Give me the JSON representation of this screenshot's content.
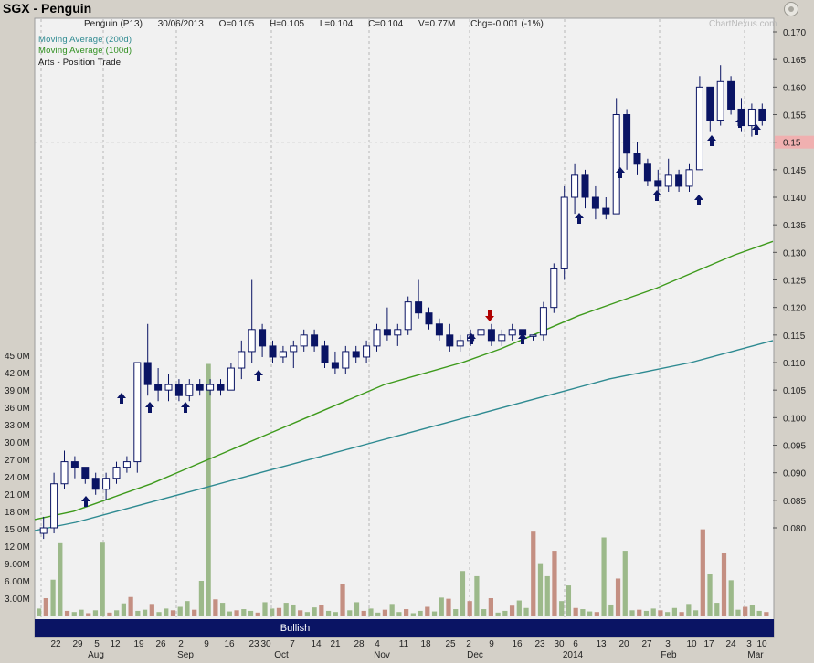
{
  "header": {
    "title": "SGX - Penguin",
    "stock": "Penguin (P13)",
    "date": "30/06/2013",
    "open": "O=0.105",
    "high": "H=0.105",
    "low": "L=0.104",
    "close": "C=0.104",
    "volume": "V=0.77M",
    "change": "Chg=-0.001 (-1%)",
    "brand": "ChartNexus.com"
  },
  "legend": {
    "ma200": "Moving Average (200d)",
    "ma100": "Moving Average (100d)",
    "arts": "Arts - Position Trade"
  },
  "status_bar": {
    "label": "Bullish"
  },
  "colors": {
    "background": "#d4d0c8",
    "plot": "#f1f1f1",
    "up_candle": "#ffffff",
    "down_candle": "#0a1464",
    "ma200": "#2e8a91",
    "ma100": "#3e9a1c",
    "vol_up": "#9cb98a",
    "vol_down": "#c48f82",
    "buy_arrow": "#0a1464",
    "sell_arrow": "#b00000",
    "status_bar": "#0a1464",
    "current_price_box": "#f0b0b0"
  },
  "chart_data": {
    "type": "candlestick",
    "price_axis": {
      "min": 0.075,
      "max": 0.17,
      "ticks": [
        "0.170",
        "0.165",
        "0.160",
        "0.155",
        "0.15",
        "0.145",
        "0.140",
        "0.135",
        "0.130",
        "0.125",
        "0.120",
        "0.115",
        "0.110",
        "0.105",
        "0.100",
        "0.095",
        "0.090",
        "0.085",
        "0.080"
      ]
    },
    "current_price": 0.15,
    "volume_axis": {
      "unit": "M",
      "max": 45,
      "ticks": [
        "45.0M",
        "42.0M",
        "39.0M",
        "36.0M",
        "33.0M",
        "30.0M",
        "27.0M",
        "24.0M",
        "21.0M",
        "18.0M",
        "15.0M",
        "12.0M",
        "9.00M",
        "6.00M",
        "3.00M"
      ]
    },
    "x_day_labels": [
      "22",
      "29",
      "5",
      "12",
      "19",
      "26",
      "2",
      "9",
      "16",
      "23",
      "30",
      "7",
      "14",
      "21",
      "28",
      "4",
      "11",
      "18",
      "25",
      "2",
      "9",
      "16",
      "23",
      "30",
      "6",
      "13",
      "20",
      "27",
      "3",
      "10",
      "17",
      "24",
      "3",
      "10"
    ],
    "x_month_labels": [
      "Aug",
      "Sep",
      "Oct",
      "Nov",
      "Dec",
      "2014",
      "Feb",
      "Mar"
    ],
    "candles": [
      [
        0.079,
        0.082,
        0.078,
        0.08
      ],
      [
        0.08,
        0.09,
        0.079,
        0.088
      ],
      [
        0.088,
        0.094,
        0.087,
        0.092
      ],
      [
        0.092,
        0.093,
        0.089,
        0.091
      ],
      [
        0.091,
        0.091,
        0.088,
        0.089
      ],
      [
        0.089,
        0.09,
        0.086,
        0.087
      ],
      [
        0.087,
        0.09,
        0.085,
        0.089
      ],
      [
        0.089,
        0.092,
        0.088,
        0.091
      ],
      [
        0.091,
        0.093,
        0.09,
        0.092
      ],
      [
        0.092,
        0.11,
        0.09,
        0.11
      ],
      [
        0.11,
        0.117,
        0.104,
        0.106
      ],
      [
        0.106,
        0.109,
        0.103,
        0.105
      ],
      [
        0.105,
        0.108,
        0.103,
        0.106
      ],
      [
        0.106,
        0.107,
        0.103,
        0.104
      ],
      [
        0.104,
        0.107,
        0.103,
        0.106
      ],
      [
        0.106,
        0.107,
        0.104,
        0.105
      ],
      [
        0.105,
        0.107,
        0.104,
        0.106
      ],
      [
        0.106,
        0.107,
        0.104,
        0.105
      ],
      [
        0.105,
        0.11,
        0.105,
        0.109
      ],
      [
        0.109,
        0.114,
        0.107,
        0.112
      ],
      [
        0.112,
        0.125,
        0.11,
        0.116
      ],
      [
        0.116,
        0.117,
        0.111,
        0.113
      ],
      [
        0.113,
        0.114,
        0.11,
        0.111
      ],
      [
        0.111,
        0.113,
        0.11,
        0.112
      ],
      [
        0.112,
        0.114,
        0.109,
        0.113
      ],
      [
        0.113,
        0.116,
        0.112,
        0.115
      ],
      [
        0.115,
        0.116,
        0.112,
        0.113
      ],
      [
        0.113,
        0.114,
        0.109,
        0.11
      ],
      [
        0.11,
        0.112,
        0.108,
        0.109
      ],
      [
        0.109,
        0.113,
        0.108,
        0.112
      ],
      [
        0.112,
        0.113,
        0.11,
        0.111
      ],
      [
        0.111,
        0.114,
        0.11,
        0.113
      ],
      [
        0.113,
        0.117,
        0.112,
        0.116
      ],
      [
        0.116,
        0.12,
        0.114,
        0.115
      ],
      [
        0.115,
        0.117,
        0.113,
        0.116
      ],
      [
        0.116,
        0.122,
        0.115,
        0.121
      ],
      [
        0.121,
        0.125,
        0.118,
        0.119
      ],
      [
        0.119,
        0.12,
        0.116,
        0.117
      ],
      [
        0.117,
        0.118,
        0.114,
        0.115
      ],
      [
        0.115,
        0.117,
        0.112,
        0.113
      ],
      [
        0.113,
        0.115,
        0.112,
        0.114
      ],
      [
        0.114,
        0.116,
        0.113,
        0.115
      ],
      [
        0.115,
        0.116,
        0.114,
        0.116
      ],
      [
        0.116,
        0.117,
        0.113,
        0.114
      ],
      [
        0.114,
        0.116,
        0.113,
        0.115
      ],
      [
        0.115,
        0.117,
        0.114,
        0.116
      ],
      [
        0.116,
        0.116,
        0.115,
        0.115
      ],
      [
        0.115,
        0.115,
        0.114,
        0.115
      ],
      [
        0.115,
        0.121,
        0.114,
        0.12
      ],
      [
        0.12,
        0.128,
        0.119,
        0.127
      ],
      [
        0.127,
        0.142,
        0.125,
        0.14
      ],
      [
        0.14,
        0.146,
        0.137,
        0.144
      ],
      [
        0.144,
        0.145,
        0.138,
        0.14
      ],
      [
        0.14,
        0.142,
        0.136,
        0.138
      ],
      [
        0.138,
        0.14,
        0.136,
        0.137
      ],
      [
        0.137,
        0.158,
        0.137,
        0.155
      ],
      [
        0.155,
        0.156,
        0.145,
        0.148
      ],
      [
        0.148,
        0.15,
        0.144,
        0.146
      ],
      [
        0.146,
        0.147,
        0.142,
        0.143
      ],
      [
        0.143,
        0.145,
        0.141,
        0.142
      ],
      [
        0.142,
        0.147,
        0.141,
        0.144
      ],
      [
        0.144,
        0.145,
        0.141,
        0.142
      ],
      [
        0.142,
        0.146,
        0.141,
        0.145
      ],
      [
        0.145,
        0.162,
        0.145,
        0.16
      ],
      [
        0.16,
        0.16,
        0.152,
        0.154
      ],
      [
        0.154,
        0.164,
        0.153,
        0.161
      ],
      [
        0.161,
        0.162,
        0.155,
        0.156
      ],
      [
        0.156,
        0.158,
        0.152,
        0.153
      ],
      [
        0.153,
        0.157,
        0.151,
        0.156
      ],
      [
        0.156,
        0.157,
        0.153,
        0.154
      ]
    ],
    "ma200": [
      0.0795,
      0.081,
      0.083,
      0.085,
      0.087,
      0.089,
      0.091,
      0.093,
      0.095,
      0.097,
      0.099,
      0.101,
      0.103,
      0.105,
      0.107,
      0.1085,
      0.11,
      0.112,
      0.114
    ],
    "ma100": [
      0.0815,
      0.083,
      0.0855,
      0.088,
      0.091,
      0.094,
      0.097,
      0.1,
      0.103,
      0.106,
      0.108,
      0.11,
      0.1125,
      0.1155,
      0.1185,
      0.121,
      0.1235,
      0.1265,
      0.1295,
      0.132
    ],
    "volumes": [
      1.2,
      3.0,
      6.2,
      12.5,
      0.8,
      0.6,
      1.0,
      0.4,
      0.9,
      12.6,
      0.5,
      0.9,
      2.1,
      3.2,
      0.8,
      1.0,
      2.0,
      0.6,
      1.2,
      0.9,
      1.5,
      2.5,
      1.0,
      6.0,
      43.5,
      2.8,
      2.2,
      0.7,
      0.9,
      1.1,
      0.8,
      0.5,
      2.3,
      1.2,
      1.3,
      2.2,
      1.9,
      0.9,
      0.6,
      1.4,
      1.8,
      0.8,
      0.6,
      5.5,
      0.9,
      2.3,
      0.8,
      1.2,
      0.5,
      1.0,
      2.0,
      0.6,
      1.1,
      0.4,
      0.8,
      1.5,
      0.7,
      3.1,
      2.9,
      1.1,
      7.7,
      2.5,
      6.8,
      1.1,
      3.0,
      0.5,
      0.8,
      1.7,
      2.6,
      1.3,
      14.5,
      8.9,
      6.8,
      11.2,
      2.5,
      5.2,
      1.3,
      1.1,
      0.7,
      0.6,
      13.5,
      1.9,
      6.4,
      11.2,
      0.9,
      1.0,
      0.8,
      1.2,
      0.9,
      0.6,
      1.3,
      0.6,
      2.0,
      0.9,
      14.9,
      7.2,
      2.2,
      10.8,
      6.1,
      1.0,
      1.5,
      1.8,
      0.8,
      0.6
    ]
  }
}
